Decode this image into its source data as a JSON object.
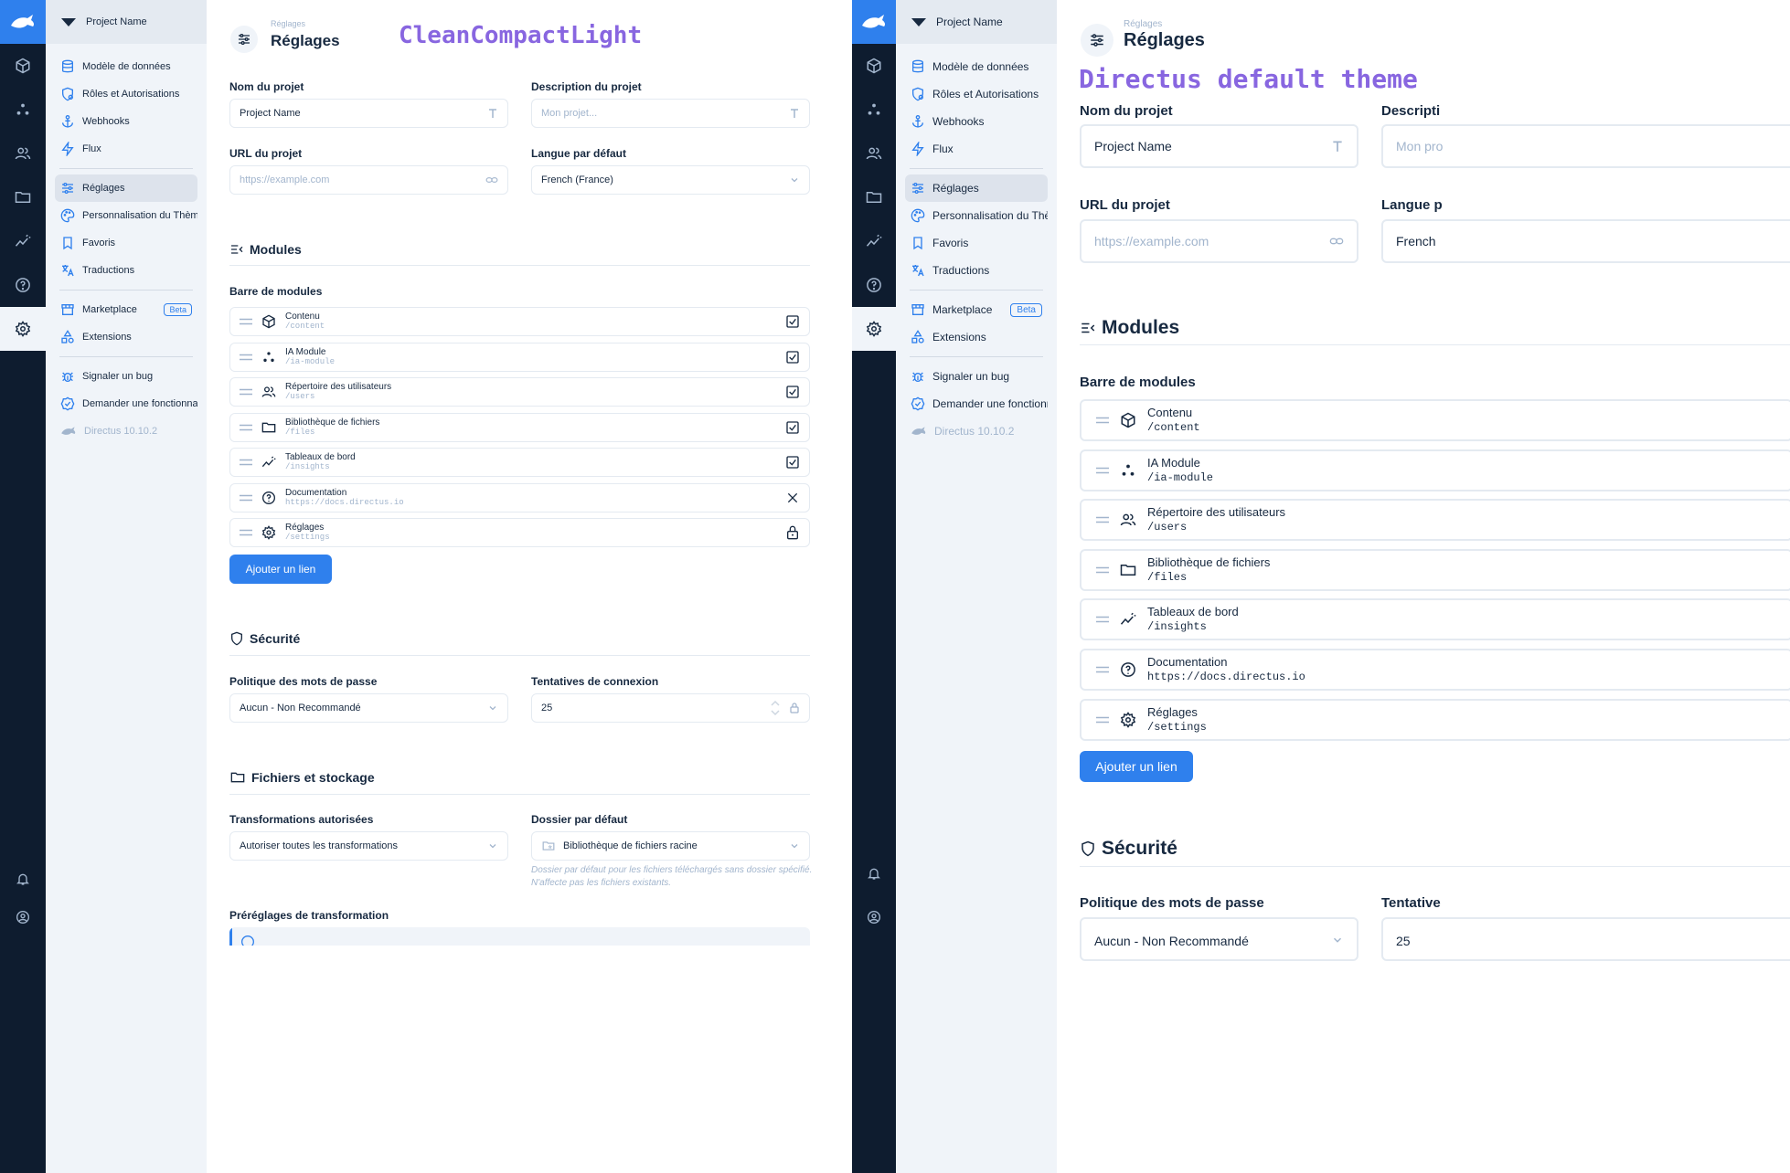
{
  "colors": {
    "accent": "#2f80ed",
    "rail": "#0e1c2f",
    "nav_bg": "#f0f4f9",
    "theme_label": "#8866e0"
  },
  "project": {
    "name": "Project Name"
  },
  "nav": {
    "items": [
      {
        "label": "Modèle de données",
        "icon": "database-icon"
      },
      {
        "label": "Rôles et Autorisations",
        "icon": "shield-user-icon"
      },
      {
        "label": "Webhooks",
        "icon": "anchor-icon"
      },
      {
        "label": "Flux",
        "icon": "bolt-icon"
      },
      {
        "label": "Réglages",
        "icon": "tune-icon"
      },
      {
        "label": "Personnalisation du Thème",
        "icon": "palette-icon"
      },
      {
        "label": "Favoris",
        "icon": "bookmark-icon"
      },
      {
        "label": "Traductions",
        "icon": "translate-icon"
      },
      {
        "label": "Marketplace",
        "icon": "store-icon"
      },
      {
        "label": "Extensions",
        "icon": "shapes-icon"
      },
      {
        "label": "Signaler un bug",
        "icon": "bug-icon"
      },
      {
        "label": "Demander une fonctionnalité",
        "icon": "verified-icon"
      },
      {
        "label": "Directus 10.10.2",
        "icon": "directus-rabbit-icon"
      }
    ],
    "beta_badge": "Beta"
  },
  "header": {
    "breadcrumb": "Réglages",
    "title": "Réglages"
  },
  "themes": {
    "left": "CleanCompactLight",
    "right": "Directus default theme"
  },
  "form": {
    "project_name_label": "Nom du projet",
    "project_name_value": "Project Name",
    "description_label": "Description du projet",
    "description_placeholder": "Mon projet...",
    "url_label": "URL du projet",
    "url_placeholder": "https://example.com",
    "language_label": "Langue par défaut",
    "language_value": "French (France)",
    "language_value_short": "French"
  },
  "modules": {
    "title": "Modules",
    "bar_label": "Barre de modules",
    "rows": [
      {
        "name": "Contenu",
        "path": "/content",
        "state": "checked"
      },
      {
        "name": "IA Module",
        "path": "/ia-module",
        "state": "checked"
      },
      {
        "name": "Répertoire des utilisateurs",
        "path": "/users",
        "state": "checked"
      },
      {
        "name": "Bibliothèque de fichiers",
        "path": "/files",
        "state": "checked"
      },
      {
        "name": "Tableaux de bord",
        "path": "/insights",
        "state": "checked"
      },
      {
        "name": "Documentation",
        "path": "https://docs.directus.io",
        "state": "remove"
      },
      {
        "name": "Réglages",
        "path": "/settings",
        "state": "locked"
      }
    ],
    "add_link": "Ajouter un lien"
  },
  "security": {
    "title": "Sécurité",
    "policy_label": "Politique des mots de passe",
    "policy_value": "Aucun - Non Recommandé",
    "attempts_label": "Tentatives de connexion",
    "attempts_label_short": "Tentative",
    "attempts_value": "25",
    "description_label_short": "Descripti",
    "description_placeholder_short": "Mon pro",
    "language_label_short": "Langue p"
  },
  "files": {
    "title": "Fichiers et stockage",
    "transforms_label": "Transformations autorisées",
    "transforms_value": "Autoriser toutes les transformations",
    "folder_label": "Dossier par défaut",
    "folder_value": "Bibliothèque de fichiers racine",
    "folder_hint": "Dossier par défaut pour les fichiers téléchargés sans dossier spécifié. N'affecte pas les fichiers existants.",
    "presets_label": "Préréglages de transformation"
  }
}
